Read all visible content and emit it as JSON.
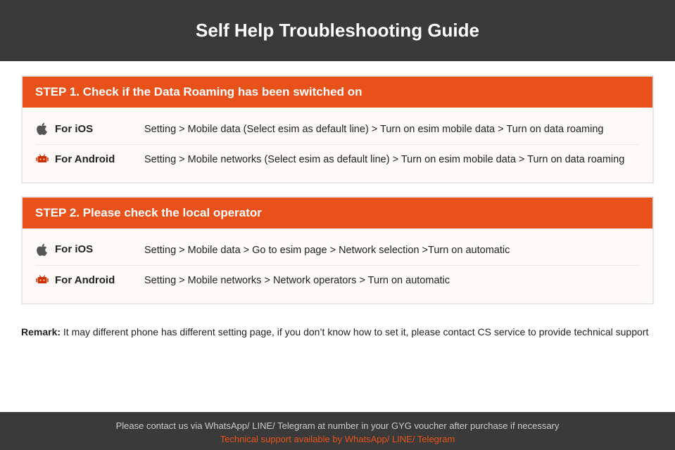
{
  "header": {
    "title": "Self Help Troubleshooting Guide"
  },
  "step1": {
    "header": "STEP 1.  Check if the Data Roaming has been switched on",
    "ios_label": "For iOS",
    "ios_text": "Setting > Mobile data (Select esim as default line) > Turn on esim mobile data > Turn on data roaming",
    "android_label": "For Android",
    "android_text": "Setting > Mobile networks (Select esim as default line) > Turn on esim mobile data > Turn on data roaming"
  },
  "step2": {
    "header": "STEP 2.  Please check the local operator",
    "ios_label": "For iOS",
    "ios_text": "Setting > Mobile data > Go to esim page > Network selection >Turn on automatic",
    "android_label": "For Android",
    "android_text": "Setting > Mobile networks > Network operators > Turn on automatic"
  },
  "remark": {
    "label": "Remark:",
    "text": "It may different phone has different setting page, if you don’t know how to set it,  please contact CS service to provide technical support"
  },
  "footer": {
    "contact_text": "Please contact us via WhatsApp/ LINE/ Telegram at number in your GYG voucher after purchase if necessary",
    "support_text": "Technical support available by WhatsApp/ LINE/ Telegram"
  }
}
